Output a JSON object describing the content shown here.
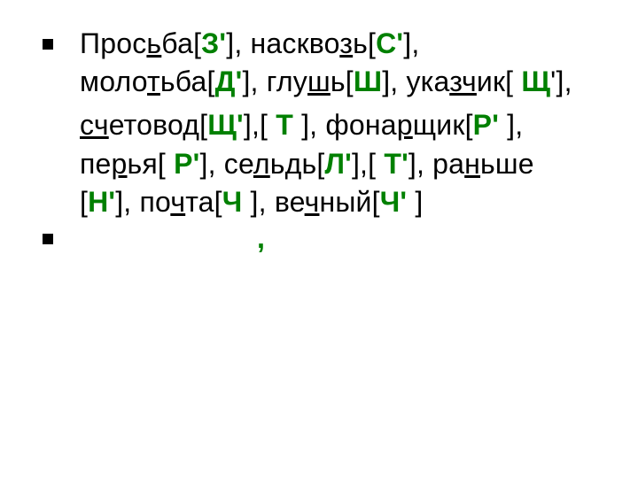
{
  "slide": {
    "para1": {
      "t1": "Прос",
      "u1": "ь",
      "t2": "ба[",
      "s1": "З'",
      "t3": "], наскво",
      "u2": "з",
      "t4": "ь[",
      "s2": "С'",
      "t5": "], моло",
      "u3": "т",
      "t6": "ьба[",
      "s3": "Д'",
      "t7": "], глу",
      "u4": "ш",
      "t8": "ь[",
      "s4": "Ш",
      "t9": "], ука",
      "u5": "зч",
      "t10": "ик[ ",
      "s5": "Щ",
      "t11": "'],"
    },
    "para2": {
      "u0": "сч",
      "t0": "етово",
      "u1": "д",
      "t1": "[",
      "s1": "Щ'",
      "t2": "],[ ",
      "s2": "Т",
      "t3": " ], фона",
      "u2": "р",
      "t4": "щик[",
      "s3": "Р'",
      "t5": " ], пе",
      "u3": "р",
      "t6": "ья[ ",
      "s4": "Р'",
      "t7": "], се",
      "u4": "л",
      "t8": "ь",
      "u5": "д",
      "t9": "ь[",
      "s5": "Л'",
      "t10": "],[ ",
      "s6": "Т'",
      "t11": "], ра",
      "u6": "н",
      "t12": "ьше [",
      "s7": "Н'",
      "t13": "], по",
      "u7": "ч",
      "t14": "та[",
      "s8": "Ч",
      "t15": "  ], ве",
      "u8": "ч",
      "t16": "ный[",
      "s9": "Ч'",
      "t17": " ]"
    },
    "trailing_comma": ","
  }
}
